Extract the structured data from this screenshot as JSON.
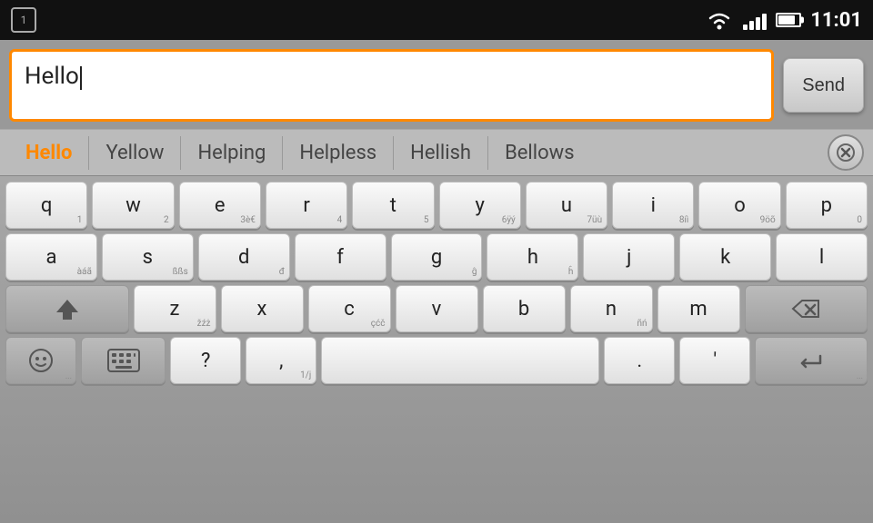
{
  "statusBar": {
    "notificationNum": "1",
    "time": "11:01"
  },
  "inputArea": {
    "textValue": "Hello",
    "sendLabel": "Send"
  },
  "suggestions": {
    "items": [
      {
        "label": "Hello",
        "active": true
      },
      {
        "label": "Yellow",
        "active": false
      },
      {
        "label": "Helping",
        "active": false
      },
      {
        "label": "Helpless",
        "active": false
      },
      {
        "label": "Hellish",
        "active": false
      },
      {
        "label": "Bellows",
        "active": false
      }
    ],
    "closeIcon": "✕"
  },
  "keyboard": {
    "rows": [
      [
        {
          "main": "q",
          "sub": "1"
        },
        {
          "main": "w",
          "sub": "2"
        },
        {
          "main": "e",
          "sub": "3εè€"
        },
        {
          "main": "r",
          "sub": "4"
        },
        {
          "main": "t",
          "sub": "5"
        },
        {
          "main": "y",
          "sub": "6ÿý"
        },
        {
          "main": "u",
          "sub": "7üù"
        },
        {
          "main": "i",
          "sub": "8íì"
        },
        {
          "main": "o",
          "sub": "9öõ"
        },
        {
          "main": "p",
          "sub": "0"
        }
      ],
      [
        {
          "main": "a",
          "sub": "àáã"
        },
        {
          "main": "s",
          "sub": "ßßs"
        },
        {
          "main": "d",
          "sub": "đ"
        },
        {
          "main": "f",
          "sub": ""
        },
        {
          "main": "g",
          "sub": "ĝ"
        },
        {
          "main": "h",
          "sub": "ĥ"
        },
        {
          "main": "j",
          "sub": ""
        },
        {
          "main": "k",
          "sub": ""
        },
        {
          "main": "l",
          "sub": ""
        }
      ],
      [
        {
          "main": "↑",
          "sub": "",
          "special": "shift"
        },
        {
          "main": "z",
          "sub": "žźż"
        },
        {
          "main": "x",
          "sub": ""
        },
        {
          "main": "c",
          "sub": "çćč"
        },
        {
          "main": "v",
          "sub": ""
        },
        {
          "main": "b",
          "sub": ""
        },
        {
          "main": "n",
          "sub": "ñń"
        },
        {
          "main": "m",
          "sub": ""
        },
        {
          "main": "⌫",
          "sub": "",
          "special": "backspace"
        }
      ],
      [
        {
          "main": "☺",
          "sub": "...",
          "special": "emoji"
        },
        {
          "main": "⌨",
          "sub": "",
          "special": "keyboard"
        },
        {
          "main": "?",
          "sub": ""
        },
        {
          "main": ",",
          "sub": "1/j"
        },
        {
          "main": " ",
          "sub": "",
          "special": "space"
        },
        {
          "main": ".",
          "sub": ""
        },
        {
          "main": "'",
          "sub": ""
        },
        {
          "main": "↵",
          "sub": "...",
          "special": "enter"
        }
      ]
    ]
  }
}
